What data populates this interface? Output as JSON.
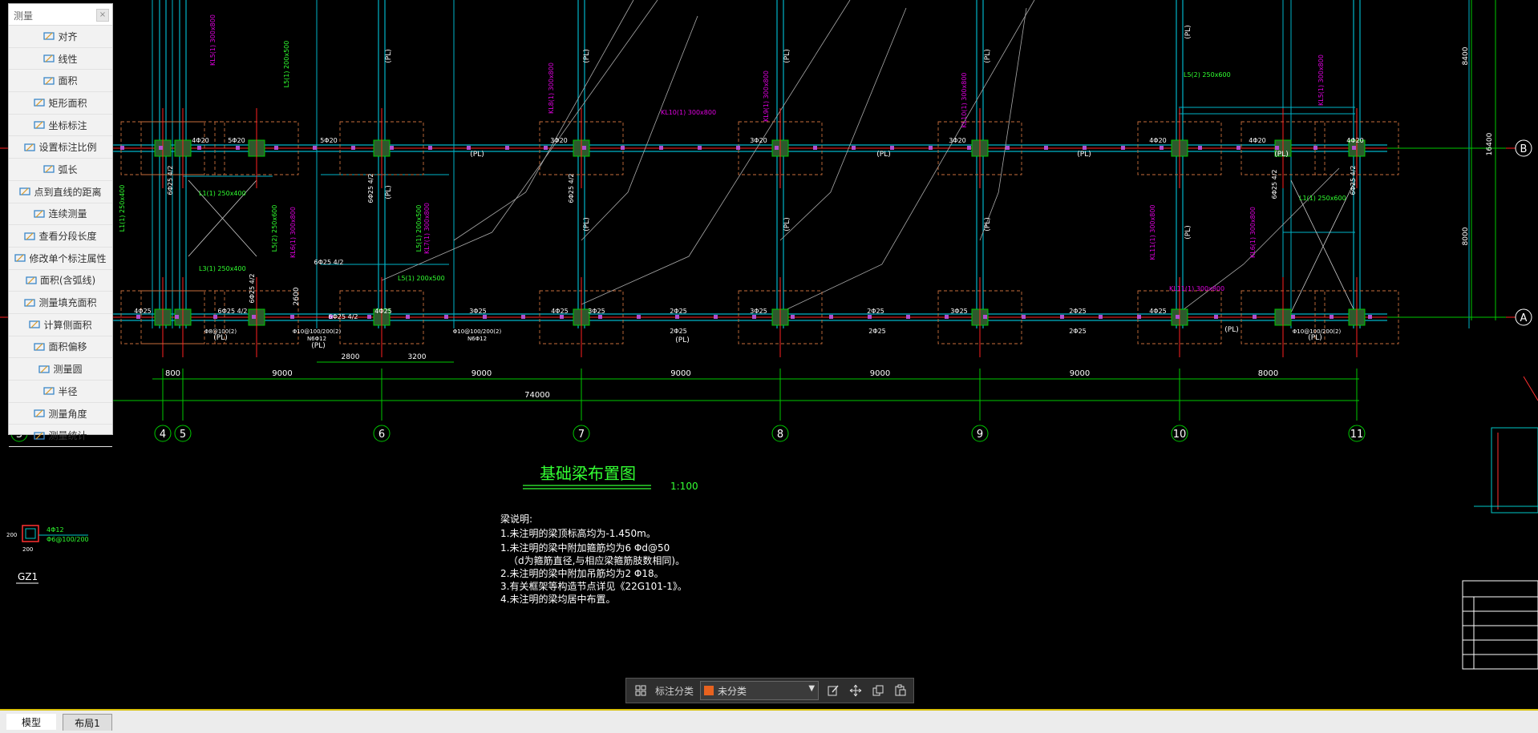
{
  "panel": {
    "title": "测量",
    "close": "×",
    "items": [
      {
        "label": "对齐",
        "icon": "align-measure-icon"
      },
      {
        "label": "线性",
        "icon": "linear-measure-icon"
      },
      {
        "label": "面积",
        "icon": "area-icon"
      },
      {
        "label": "矩形面积",
        "icon": "rect-area-icon"
      },
      {
        "label": "坐标标注",
        "icon": "coordinate-icon"
      },
      {
        "label": "设置标注比例",
        "icon": "scale-icon"
      },
      {
        "label": "弧长",
        "icon": "arc-length-icon"
      },
      {
        "label": "点到直线的距离",
        "icon": "point-line-distance-icon"
      },
      {
        "label": "连续测量",
        "icon": "continuous-measure-icon"
      },
      {
        "label": "查看分段长度",
        "icon": "segment-length-icon"
      },
      {
        "label": "修改单个标注属性",
        "icon": "edit-annotation-icon"
      },
      {
        "label": "面积(含弧线)",
        "icon": "arc-area-icon"
      },
      {
        "label": "测量填充面积",
        "icon": "fill-area-icon"
      },
      {
        "label": "计算侧面积",
        "icon": "side-area-icon"
      },
      {
        "label": "面积偏移",
        "icon": "area-offset-icon"
      },
      {
        "label": "测量圆",
        "icon": "circle-measure-icon"
      },
      {
        "label": "半径",
        "icon": "radius-icon"
      },
      {
        "label": "测量角度",
        "icon": "angle-icon"
      },
      {
        "label": "测量统计",
        "icon": "statistics-icon"
      }
    ]
  },
  "drawing": {
    "title": "基础梁布置图",
    "scale": "1:100",
    "notes": [
      "梁说明:",
      "1.未注明的梁顶标高均为-1.450m。",
      "1.未注明的梁中附加箍筋均为6 Φd@50",
      "（d为箍筋直径,与相应梁箍筋肢数相同)。",
      "2.未注明的梁中附加吊筋均为2 Φ18。",
      "3.有关框架等构造节点详见《22G101-1》。",
      "4.未注明的梁均居中布置。"
    ],
    "axes": [
      "4",
      "5",
      "6",
      "7",
      "8",
      "9",
      "10",
      "11"
    ],
    "left_axis_partial": "3",
    "spans": [
      "800",
      "9000",
      "9000",
      "9000",
      "9000",
      "9000",
      "8000"
    ],
    "total_dimension": "74000",
    "row_labels": [
      "B",
      "A"
    ],
    "right_dims": [
      "8400",
      "8000",
      "16400"
    ],
    "sub_dims": [
      "2800",
      "3200",
      "2600"
    ],
    "gz_label": "GZ1",
    "gz_rebar": [
      "4Φ12",
      "Φ6@100/200"
    ],
    "gz_size": "200",
    "pl": "(PL)",
    "beam_rebar_top": [
      "4Φ20",
      "5Φ20",
      "5Φ20",
      "3Φ20",
      "3Φ20",
      "3Φ20",
      "4Φ20",
      "4Φ20",
      "4Φ20"
    ],
    "beam_rebar_bottom": [
      "4Φ25",
      "6Φ25 4/2",
      "4Φ25",
      "3Φ25",
      "4Φ25",
      "3Φ25",
      "2Φ25",
      "3Φ25",
      "2Φ25",
      "3Φ25",
      "2Φ25",
      "4Φ25"
    ],
    "bottom_rebar_lower": [
      "2Φ25",
      "2Φ25",
      "2Φ25"
    ],
    "stirrups": [
      "Φ10@100/200(2)",
      "N6Φ12",
      "Φ8@100(2)"
    ],
    "vertical_rebar": "6Φ25 4/2",
    "magenta_labels": [
      "KL5(1) 300x800",
      "KL6(1) 300x800",
      "KL7(1) 300x800",
      "KL8(1) 300x800",
      "KL9(1) 300x800",
      "KL10(1) 300x800",
      "KL11(1) 300x800"
    ],
    "green_labels": [
      "L1(1) 250x400",
      "L3(1) 250x400",
      "L5(1) 200x500",
      "L5(2) 250x600",
      "L1(1) 250x600"
    ]
  },
  "annotation_toolbar": {
    "label": "标注分类",
    "selected": "未分类",
    "swatch_color": "#e8621f"
  },
  "tabs": {
    "model": "模型",
    "layout": "布局1"
  },
  "colors": {
    "background": "#000000",
    "axis_green": "#00c800",
    "beam_cyan": "#00b4c8",
    "column_red": "#ff2020",
    "magenta_text": "#e000e0",
    "green_text": "#30ff30",
    "dashed_box": "#c86e3c"
  }
}
